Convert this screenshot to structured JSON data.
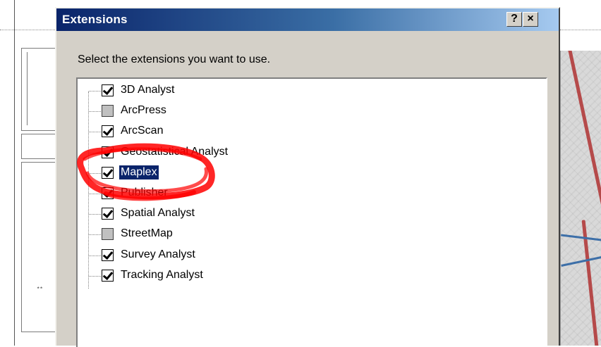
{
  "dialog": {
    "title": "Extensions",
    "help_button": "?",
    "close_button": "×",
    "instruction": "Select the extensions you want to use.",
    "extensions": [
      {
        "label": "3D Analyst",
        "state": "checked"
      },
      {
        "label": "ArcPress",
        "state": "grayed"
      },
      {
        "label": "ArcScan",
        "state": "checked"
      },
      {
        "label": "Geostatistical Analyst",
        "state": "checked"
      },
      {
        "label": "Maplex",
        "state": "checked",
        "selected": true
      },
      {
        "label": "Publisher",
        "state": "checked"
      },
      {
        "label": "Spatial Analyst",
        "state": "checked"
      },
      {
        "label": "StreetMap",
        "state": "grayed"
      },
      {
        "label": "Survey Analyst",
        "state": "checked"
      },
      {
        "label": "Tracking Analyst",
        "state": "checked"
      }
    ]
  },
  "colors": {
    "dialog_face": "#d4d0c8",
    "title_gradient_start": "#0a246a",
    "title_gradient_end": "#a6caf0",
    "selection": "#0a246a",
    "annotation_scribble": "#ff0000"
  },
  "icons": {
    "help": "question-mark-icon",
    "close": "close-icon",
    "checked": "checkmark-icon"
  }
}
